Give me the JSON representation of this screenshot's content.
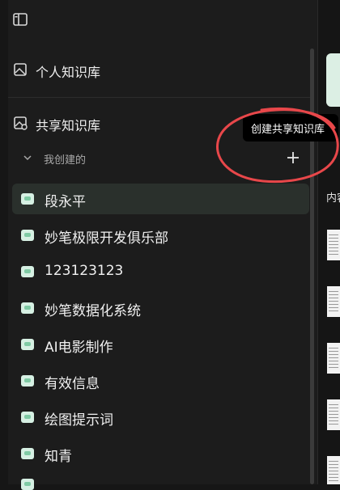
{
  "sidebar": {
    "personal_kb": "个人知识库",
    "shared_kb": "共享知识库",
    "group_label": "我创建的",
    "items": [
      {
        "label": "段永平"
      },
      {
        "label": "妙笔极限开发俱乐部"
      },
      {
        "label": "123123123"
      },
      {
        "label": "妙笔数据化系统"
      },
      {
        "label": "AI电影制作"
      },
      {
        "label": "有效信息"
      },
      {
        "label": "绘图提示词"
      },
      {
        "label": "知青"
      }
    ]
  },
  "tooltip": {
    "text": "创建共享知识库"
  },
  "right_pane": {
    "partial_text": "内容"
  },
  "colors": {
    "accent": "#7fcaa4",
    "annotation": "#e8474a",
    "tooltip_bg": "#000000"
  }
}
